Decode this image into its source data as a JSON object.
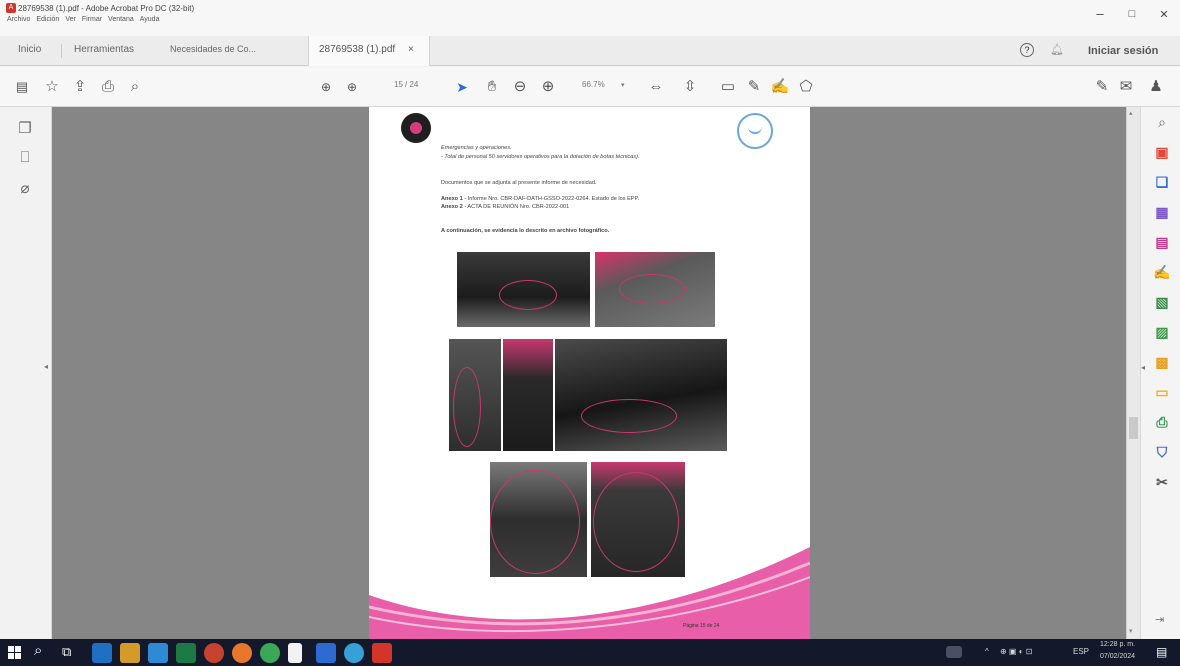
{
  "window": {
    "title": "28769538 (1).pdf - Adobe Acrobat Pro DC (32-bit)",
    "menus": [
      "Archivo",
      "Edición",
      "Ver",
      "Firmar",
      "Ventana",
      "Ayuda"
    ],
    "minimize": "–",
    "maximize": "□",
    "close": "✕"
  },
  "tabs": {
    "home": "Inicio",
    "tools": "Herramientas",
    "doc1": "Necesidades de Co...",
    "doc2": "28769538 (1).pdf",
    "doc2_close": "×",
    "help": "?",
    "signin": "Iniciar sesión"
  },
  "toolbar": {
    "page_current": "15",
    "page_total": "/ 24",
    "zoom": "66.7%"
  },
  "document": {
    "line1": "Emergencias y operaciones.",
    "line2": "- Total de personal 50 servidores operativos para la dotación de botas técnicas).",
    "line3": "Documentos que se adjunta al presente informe de necesidad.",
    "line4a_bold": "Anexo 1",
    "line4a": " - Informe Nro. CBR-DAF-DATH-GSSO-2022-0264. Estado de los EPP.",
    "line4b_bold": "Anexo 2",
    "line4b": " - ACTA DE REUNIÓN Nro. CBR-2022-001",
    "line5": "A continuación, se evidencia lo descrito en archivo fotográfico.",
    "footer": "Página 15 de 24"
  },
  "taskbar": {
    "lang": "ESP",
    "time": "12:28 p. m.",
    "date": "07/02/2024"
  },
  "colors": {
    "accent": "#c7386e",
    "acrobat_red": "#d4352b",
    "viewer_bg": "#868686",
    "taskbar": "#13182a"
  }
}
